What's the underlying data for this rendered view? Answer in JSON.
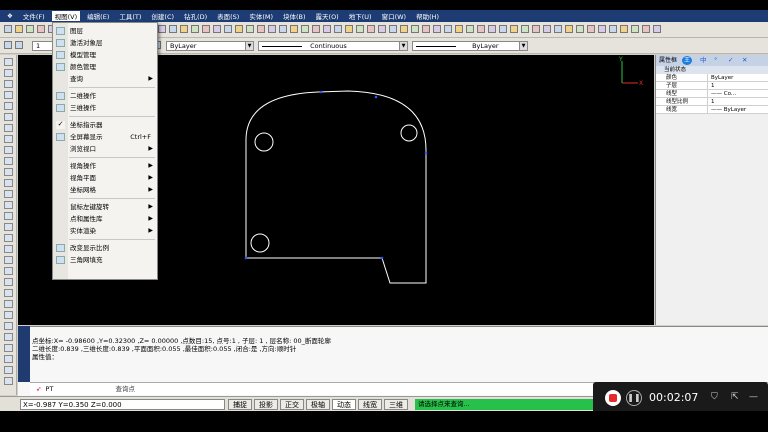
{
  "menubar": {
    "items": [
      "文件(F)",
      "视图(V)",
      "编辑(E)",
      "工具(T)",
      "创建(C)",
      "钻孔(D)",
      "表面(S)",
      "实体(M)",
      "块体(B)",
      "露天(O)",
      "地下(U)",
      "窗口(W)",
      "帮助(H)"
    ],
    "active_index": 1
  },
  "layer_bar": {
    "layer_number": "1",
    "color_label": "ByLayer",
    "linetype_label": "Continuous",
    "lineweight_label": "ByLayer"
  },
  "view_menu": {
    "items": [
      {
        "label": "图层",
        "icon": "layers-icon",
        "shortcut": "",
        "submenu": false
      },
      {
        "label": "激活对象层",
        "icon": "activate-layer-icon",
        "shortcut": "",
        "submenu": false
      },
      {
        "label": "模型管理",
        "icon": "model-manager-icon",
        "shortcut": "",
        "submenu": false
      },
      {
        "label": "颜色管理",
        "icon": "color-manager-icon",
        "shortcut": "",
        "submenu": false
      },
      {
        "label": "查询",
        "icon": "",
        "shortcut": "",
        "submenu": true
      },
      {
        "label": "二维操作",
        "icon": "2d-operation-icon",
        "shortcut": "",
        "submenu": false
      },
      {
        "label": "三维操作",
        "icon": "3d-operation-icon",
        "shortcut": "",
        "submenu": false
      },
      {
        "label": "坐标指示器",
        "icon": "check-icon",
        "shortcut": "",
        "submenu": false
      },
      {
        "label": "全屏幕显示",
        "icon": "fullscreen-icon",
        "shortcut": "Ctrl+F",
        "submenu": false
      },
      {
        "label": "浏览视口",
        "icon": "",
        "shortcut": "",
        "submenu": true
      },
      {
        "label": "视角操作",
        "icon": "",
        "shortcut": "",
        "submenu": true
      },
      {
        "label": "视角平面",
        "icon": "",
        "shortcut": "",
        "submenu": true
      },
      {
        "label": "坐标网格",
        "icon": "",
        "shortcut": "",
        "submenu": true
      },
      {
        "label": "鼠标左键旋转",
        "icon": "",
        "shortcut": "",
        "submenu": true
      },
      {
        "label": "点和属性库",
        "icon": "",
        "shortcut": "",
        "submenu": true
      },
      {
        "label": "实体渲染",
        "icon": "",
        "shortcut": "",
        "submenu": true
      },
      {
        "label": "改变显示比例",
        "icon": "scale-icon",
        "shortcut": "",
        "submenu": false
      },
      {
        "label": "三角网填充",
        "icon": "tin-fill-icon",
        "shortcut": "",
        "submenu": false
      }
    ]
  },
  "properties": {
    "title": "属性框",
    "tab_icons": [
      "中",
      "°",
      "✓",
      "✕"
    ],
    "group": "当前状态",
    "rows": [
      {
        "key": "颜色",
        "value": "ByLayer"
      },
      {
        "key": "子层",
        "value": "1"
      },
      {
        "key": "线型",
        "value": "—— Co..."
      },
      {
        "key": "线型比例",
        "value": "1"
      },
      {
        "key": "线宽",
        "value": "—— ByLayer"
      }
    ]
  },
  "command": {
    "lines": [
      "点坐标:X= -0.98600 ,Y=0.32300 ,Z= 0.00000 ,点数目:15, 点号:1 , 子层: 1 , 层名称: 00_断面轮廓",
      "二维长度:0.839 ,三维长度:0.839 ,平面面积:0.055 ,最佳面积:0.055 ,闭合:是 ,方向:顺时针",
      "属性值："
    ],
    "prompt": "PT",
    "prompt_hint": "查询点"
  },
  "status": {
    "coords": "X=-0.987 Y=0.350 Z=0.000",
    "buttons": [
      "捕捉",
      "投影",
      "正交",
      "极轴",
      "动态",
      "线宽",
      "三维"
    ],
    "message": "请选择点来查询..."
  },
  "recorder": {
    "time": "00:02:07"
  },
  "axis": {
    "x": "X",
    "y": "Y"
  }
}
